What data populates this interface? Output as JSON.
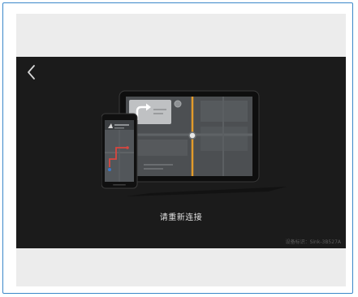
{
  "screen": {
    "status_text": "请重新连接",
    "device_id_text": "设备标识：Sink-3B527A",
    "icons": {
      "back": "chevron-left-icon",
      "illustration": "phone-to-car-display-illustration"
    },
    "colors": {
      "background": "#1b1b1b",
      "route_accent": "#e39b2b",
      "phone_route_red": "#d9463f",
      "phone_route_blue": "#3b78c9"
    }
  }
}
